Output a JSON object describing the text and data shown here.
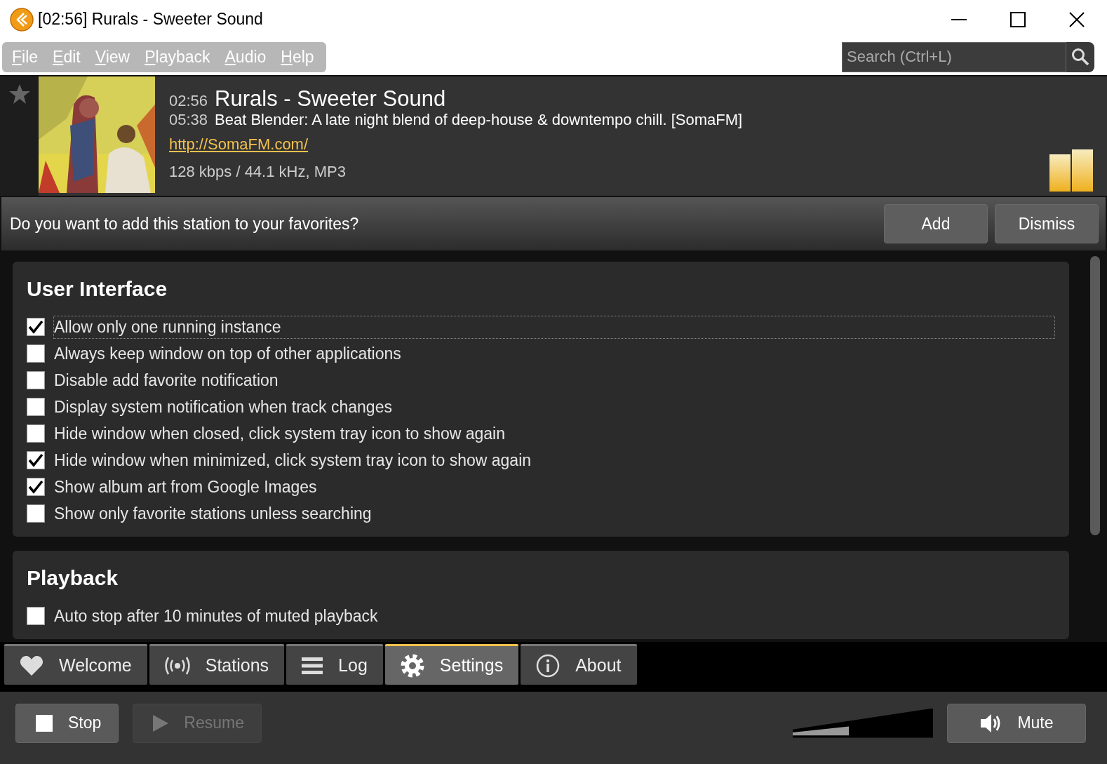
{
  "window": {
    "title": "[02:56] Rurals - Sweeter Sound"
  },
  "menu": [
    "File",
    "Edit",
    "View",
    "Playback",
    "Audio",
    "Help"
  ],
  "search": {
    "placeholder": "Search (Ctrl+L)"
  },
  "now_playing": {
    "favorite": false,
    "track_time": "02:56",
    "track": "Rurals - Sweeter Sound",
    "station_time": "05:38",
    "station": "Beat Blender: A late night blend of deep-house & downtempo chill. [SomaFM]",
    "url": "http://SomaFM.com/",
    "format": "128 kbps / 44.1 kHz, MP3"
  },
  "notification": {
    "text": "Do you want to add this station to your favorites?",
    "buttons": [
      "Add",
      "Dismiss"
    ]
  },
  "settings": [
    {
      "title": "User Interface",
      "options": [
        {
          "label": "Allow only one running instance",
          "checked": true,
          "focused": true
        },
        {
          "label": "Always keep window on top of other applications",
          "checked": false,
          "focused": false
        },
        {
          "label": "Disable add favorite notification",
          "checked": false,
          "focused": false
        },
        {
          "label": "Display system notification when track changes",
          "checked": false,
          "focused": false
        },
        {
          "label": "Hide window when closed, click system tray icon to show again",
          "checked": false,
          "focused": false
        },
        {
          "label": "Hide window when minimized, click system tray icon to show again",
          "checked": true,
          "focused": false
        },
        {
          "label": "Show album art from Google Images",
          "checked": true,
          "focused": false
        },
        {
          "label": "Show only favorite stations unless searching",
          "checked": false,
          "focused": false
        }
      ]
    },
    {
      "title": "Playback",
      "options": [
        {
          "label": "Auto stop after 10 minutes of muted playback",
          "checked": false,
          "focused": false
        }
      ]
    }
  ],
  "tabs": [
    {
      "label": "Welcome",
      "kind": "heart",
      "selected": false
    },
    {
      "label": "Stations",
      "kind": "broadcast",
      "selected": false
    },
    {
      "label": "Log",
      "kind": "list",
      "selected": false
    },
    {
      "label": "Settings",
      "kind": "gear",
      "selected": true
    },
    {
      "label": "About",
      "kind": "info",
      "selected": false
    }
  ],
  "controls": {
    "stop": {
      "label": "Stop",
      "disabled": false
    },
    "resume": {
      "label": "Resume",
      "disabled": true
    },
    "volume": {
      "level": 0.4
    },
    "mute": {
      "label": "Mute"
    }
  }
}
